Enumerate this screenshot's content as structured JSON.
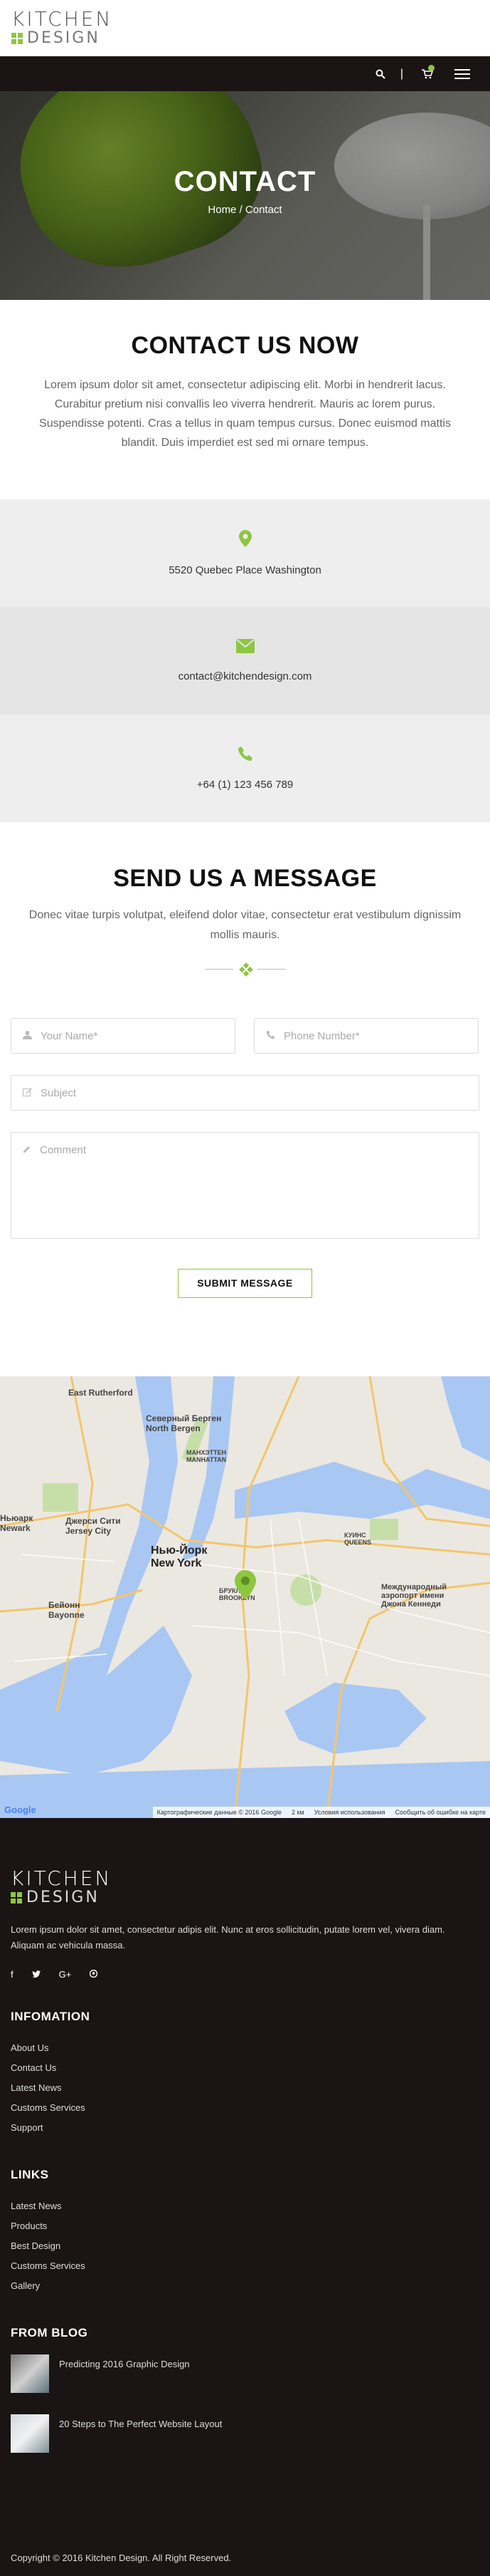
{
  "brand": {
    "line1": "KITCHEN",
    "line2": "DESIGN",
    "accent": "#8dc63f"
  },
  "header": {
    "search_icon": "search-icon",
    "separator": "|",
    "cart_icon": "cart-icon",
    "menu_icon": "hamburger-icon"
  },
  "hero": {
    "title": "CONTACT",
    "breadcrumb": "Home / Contact"
  },
  "contact_now": {
    "title": "CONTACT US NOW",
    "text": "Lorem ipsum dolor sit amet, consectetur adipiscing elit. Morbi in hendrerit lacus. Curabitur pretium nisi convallis leo viverra hendrerit. Mauris ac lorem purus. Suspendisse potenti. Cras a tellus in quam tempus cursus. Donec euismod mattis blandit. Duis imperdiet est sed mi ornare tempus."
  },
  "info": {
    "address": "5520 Quebec Place Washington",
    "email": "contact@kitchendesign.com",
    "phone": "+64 (1) 123 456 789"
  },
  "send": {
    "title": "SEND US A MESSAGE",
    "text": "Donec vitae turpis volutpat, eleifend dolor vitae, consectetur erat vestibulum dignissim mollis mauris."
  },
  "form": {
    "name_placeholder": "Your Name*",
    "phone_placeholder": "Phone Number*",
    "subject_placeholder": "Subject",
    "comment_placeholder": "Comment",
    "submit_label": "SUBMIT MESSAGE"
  },
  "map": {
    "labels": {
      "rutherford": "East Rutherford",
      "north_bergen": "Северный Берген North Bergen",
      "manhattan": "МАНХЭТТЕН MANHATTAN",
      "jersey_city": "Джерси Сити Jersey City",
      "new_york": "Нью-Йорк New York",
      "bayonne": "Бейонн Bayonne",
      "brooklyn": "БРУКЛИН BROOKLYN",
      "queens": "КУИНС QUEENS",
      "jfk": "Международный аэропорт имени Джона Кеннеди",
      "newark": "Ньюарк Newark"
    },
    "google": "Google",
    "attribution": "Картографические данные © 2016 Google",
    "scale": "2 км",
    "terms": "Условия использования",
    "report": "Сообщить об ошибке на карте"
  },
  "footer": {
    "about": "Lorem ipsum dolor sit amet, consectetur adipis elit. Nunc at eros sollicitudin, putate lorem vel, vivera diam. Aliquam ac vehicula massa.",
    "social": [
      "f",
      "t",
      "G+",
      "p"
    ],
    "info_title": "INFOMATION",
    "info_links": [
      "About Us",
      "Contact Us",
      "Latest News",
      "Customs Services",
      "Support"
    ],
    "links_title": "LINKS",
    "links": [
      "Latest News",
      "Products",
      "Best Design",
      "Customs Services",
      "Gallery"
    ],
    "blog_title": "FROM BLOG",
    "posts": [
      "Predicting 2016 Graphic Design",
      "20 Steps to The Perfect Website Layout"
    ],
    "copyright": "Copyright © 2016 Kitchen Design. All Right Reserved."
  }
}
